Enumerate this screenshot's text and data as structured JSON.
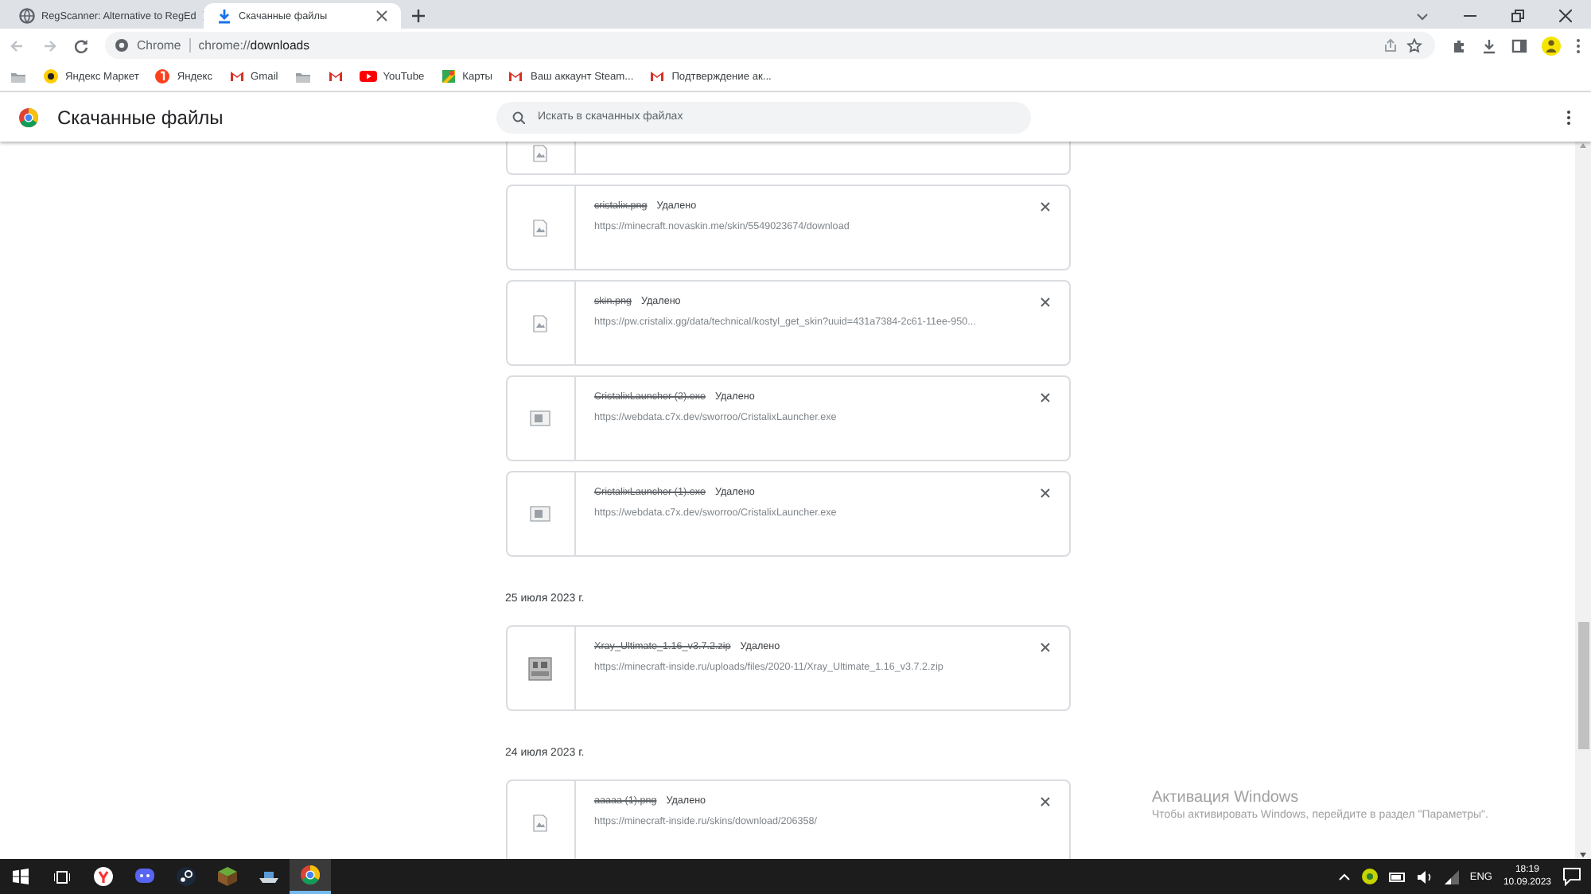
{
  "tabs": [
    {
      "title": "RegScanner: Alternative to RegEd",
      "selected": false
    },
    {
      "title": "Скачанные файлы",
      "selected": true
    }
  ],
  "address": {
    "scheme": "Chrome",
    "url_prefix": "chrome://",
    "url_path": "downloads"
  },
  "bookmarks": [
    {
      "kind": "icon"
    },
    {
      "label": "Яндекс Маркет"
    },
    {
      "label": "Яндекс"
    },
    {
      "label": "Gmail"
    },
    {
      "kind": "icon"
    },
    {
      "kind": "icon"
    },
    {
      "label": "YouTube"
    },
    {
      "label": "Карты"
    },
    {
      "label": "Ваш аккаунт Steam..."
    },
    {
      "label": "Подтверждение ак..."
    }
  ],
  "page": {
    "title": "Скачанные файлы",
    "search_placeholder": "Искать в скачанных файлах"
  },
  "groups": [
    {
      "items": [
        {
          "kind": "image"
        },
        {
          "kind": "image",
          "name": "cristalix.png",
          "removed": true,
          "status": "Удалено",
          "url": "https://minecraft.novaskin.me/skin/5549023674/download"
        },
        {
          "kind": "image",
          "name": "skin.png",
          "removed": true,
          "status": "Удалено",
          "url": "https://pw.cristalix.gg/data/technical/kostyl_get_skin?uuid=431a7384-2c61-11ee-950..."
        },
        {
          "kind": "program",
          "name": "CristalixLauncher (2).exe",
          "removed": true,
          "status": "Удалено",
          "url": "https://webdata.c7x.dev/sworroo/CristalixLauncher.exe"
        },
        {
          "kind": "program",
          "name": "CristalixLauncher (1).exe",
          "removed": true,
          "status": "Удалено",
          "url": "https://webdata.c7x.dev/sworroo/CristalixLauncher.exe"
        }
      ]
    },
    {
      "date": "25 июля 2023 г.",
      "items": [
        {
          "kind": "archive",
          "name": "Xray_Ultimate_1.16_v3.7.2.zip",
          "removed": true,
          "status": "Удалено",
          "url": "https://minecraft-inside.ru/uploads/files/2020-11/Xray_Ultimate_1.16_v3.7.2.zip"
        }
      ]
    },
    {
      "date": "24 июля 2023 г.",
      "items": [
        {
          "kind": "image",
          "name": "aaaaa (1).png",
          "removed": true,
          "status": "Удалено",
          "url": "https://minecraft-inside.ru/skins/download/206358/"
        }
      ]
    }
  ],
  "activation": {
    "title": "Активация Windows",
    "text": "Чтобы активировать Windows, перейдите в раздел \"Параметры\"."
  },
  "taskbar": {
    "apps": [
      {
        "active": false
      },
      {
        "active": false
      },
      {
        "active": false
      },
      {
        "active": false
      },
      {
        "active": false
      },
      {
        "active": true
      }
    ],
    "language": "ENG",
    "time": "18:19",
    "date": "10.09.2023"
  }
}
